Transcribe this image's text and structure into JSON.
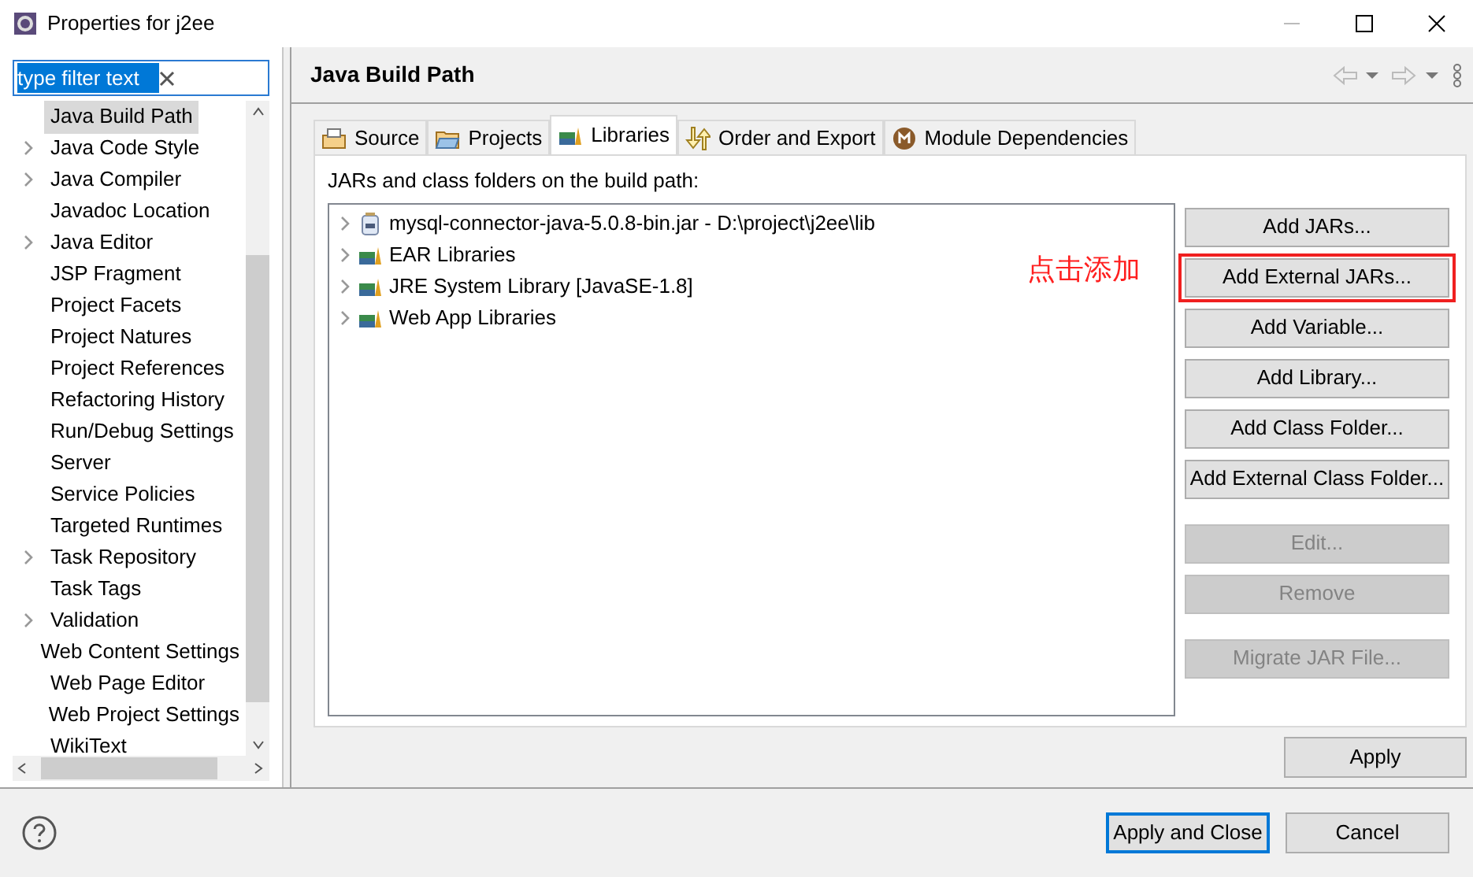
{
  "window": {
    "title": "Properties for j2ee"
  },
  "filter": {
    "value": "type filter text",
    "text_selected": true
  },
  "sidebar": {
    "items": [
      {
        "label": "Java Build Path",
        "expandable": false,
        "selected": true
      },
      {
        "label": "Java Code Style",
        "expandable": true,
        "selected": false
      },
      {
        "label": "Java Compiler",
        "expandable": true,
        "selected": false
      },
      {
        "label": "Javadoc Location",
        "expandable": false,
        "selected": false
      },
      {
        "label": "Java Editor",
        "expandable": true,
        "selected": false
      },
      {
        "label": "JSP Fragment",
        "expandable": false,
        "selected": false
      },
      {
        "label": "Project Facets",
        "expandable": false,
        "selected": false
      },
      {
        "label": "Project Natures",
        "expandable": false,
        "selected": false
      },
      {
        "label": "Project References",
        "expandable": false,
        "selected": false
      },
      {
        "label": "Refactoring History",
        "expandable": false,
        "selected": false
      },
      {
        "label": "Run/Debug Settings",
        "expandable": false,
        "selected": false
      },
      {
        "label": "Server",
        "expandable": false,
        "selected": false
      },
      {
        "label": "Service Policies",
        "expandable": false,
        "selected": false
      },
      {
        "label": "Targeted Runtimes",
        "expandable": false,
        "selected": false
      },
      {
        "label": "Task Repository",
        "expandable": true,
        "selected": false
      },
      {
        "label": "Task Tags",
        "expandable": false,
        "selected": false
      },
      {
        "label": "Validation",
        "expandable": true,
        "selected": false
      },
      {
        "label": "Web Content Settings",
        "expandable": false,
        "selected": false
      },
      {
        "label": "Web Page Editor",
        "expandable": false,
        "selected": false
      },
      {
        "label": "Web Project Settings",
        "expandable": false,
        "selected": false
      },
      {
        "label": "WikiText",
        "expandable": false,
        "selected": false
      }
    ]
  },
  "page": {
    "title": "Java Build Path"
  },
  "tabs": [
    {
      "label": "Source",
      "kind": "source",
      "selected": false
    },
    {
      "label": "Projects",
      "kind": "projects",
      "selected": false
    },
    {
      "label": "Libraries",
      "kind": "libraries",
      "selected": true
    },
    {
      "label": "Order and Export",
      "kind": "order",
      "selected": false
    },
    {
      "label": "Module Dependencies",
      "kind": "module",
      "selected": false
    }
  ],
  "build_path": {
    "label": "JARs and class folders on the build path:",
    "entries": [
      {
        "label": "mysql-connector-java-5.0.8-bin.jar - D:\\project\\j2ee\\lib",
        "kind": "jar"
      },
      {
        "label": "EAR Libraries",
        "kind": "library"
      },
      {
        "label": "JRE System Library [JavaSE-1.8]",
        "kind": "library"
      },
      {
        "label": "Web App Libraries",
        "kind": "library"
      }
    ]
  },
  "annotation": {
    "text": "点击添加"
  },
  "button_groups": [
    {
      "buttons": [
        {
          "label": "Add JARs...",
          "disabled": false,
          "highlighted": false
        },
        {
          "label": "Add External JARs...",
          "disabled": false,
          "highlighted": true
        },
        {
          "label": "Add Variable...",
          "disabled": false,
          "highlighted": false
        },
        {
          "label": "Add Library...",
          "disabled": false,
          "highlighted": false
        },
        {
          "label": "Add Class Folder...",
          "disabled": false,
          "highlighted": false
        },
        {
          "label": "Add External Class Folder...",
          "disabled": false,
          "highlighted": false
        }
      ]
    },
    {
      "buttons": [
        {
          "label": "Edit...",
          "disabled": true,
          "highlighted": false
        },
        {
          "label": "Remove",
          "disabled": true,
          "highlighted": false
        }
      ]
    },
    {
      "buttons": [
        {
          "label": "Migrate JAR File...",
          "disabled": true,
          "highlighted": false
        }
      ]
    }
  ],
  "apply_button": {
    "label": "Apply"
  },
  "footer": {
    "buttons": [
      {
        "label": "Apply and Close",
        "default": true
      },
      {
        "label": "Cancel",
        "default": false
      }
    ]
  }
}
